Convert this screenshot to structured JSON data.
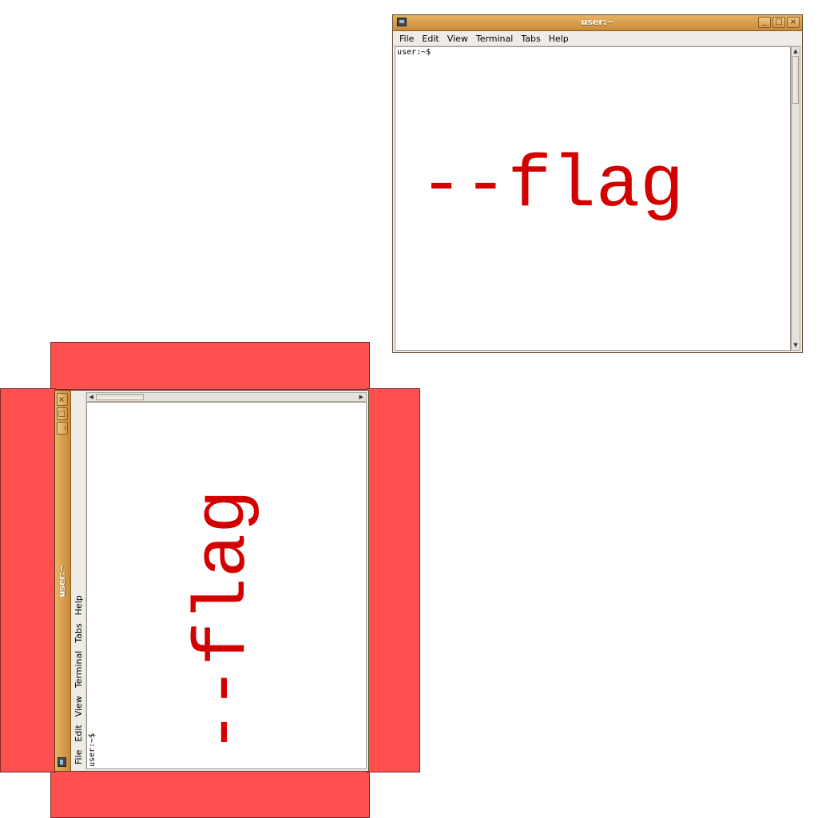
{
  "window": {
    "title": "user:~",
    "buttons": {
      "minimize": "_",
      "maximize": "□",
      "close": "×"
    },
    "menu": [
      "File",
      "Edit",
      "View",
      "Terminal",
      "Tabs",
      "Help"
    ],
    "prompt": "user:~$",
    "content_text": "--flag"
  },
  "rotated_window": {
    "title": "user:~",
    "buttons": {
      "minimize": "_",
      "maximize": "□",
      "close": "×"
    },
    "menu": [
      "File",
      "Edit",
      "View",
      "Terminal",
      "Tabs",
      "Help"
    ],
    "prompt": "user:~$",
    "content_text": "--flag"
  },
  "colors": {
    "highlight_red": "#ff4f4f",
    "flag_text": "#d40000",
    "titlebar": "#d89c4e"
  }
}
